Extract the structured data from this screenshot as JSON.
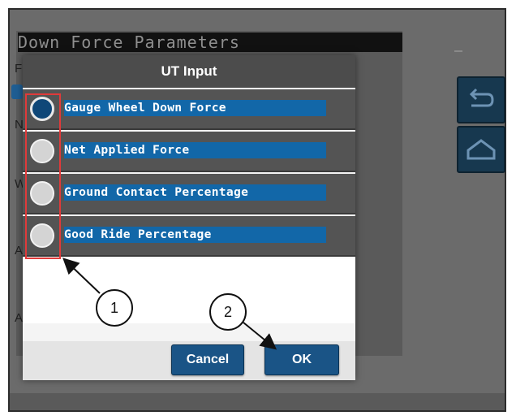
{
  "background": {
    "title": "Down Force Parameters",
    "side_letters": [
      "F",
      "N",
      "W",
      "A",
      "A"
    ]
  },
  "side_buttons": [
    {
      "icon": "back-arrow-icon"
    },
    {
      "icon": "home-icon"
    }
  ],
  "dialog": {
    "title": "UT Input",
    "options": [
      {
        "label": "Gauge Wheel Down Force",
        "selected": true
      },
      {
        "label": "Net Applied Force",
        "selected": false
      },
      {
        "label": "Ground Contact Percentage",
        "selected": false
      },
      {
        "label": "Good Ride Percentage",
        "selected": false
      }
    ],
    "cancel_label": "Cancel",
    "ok_label": "OK"
  },
  "callouts": {
    "one": "1",
    "two": "2"
  },
  "colors": {
    "accent": "#1267a8",
    "button": "#1a5486",
    "highlight": "#e03a3a"
  }
}
